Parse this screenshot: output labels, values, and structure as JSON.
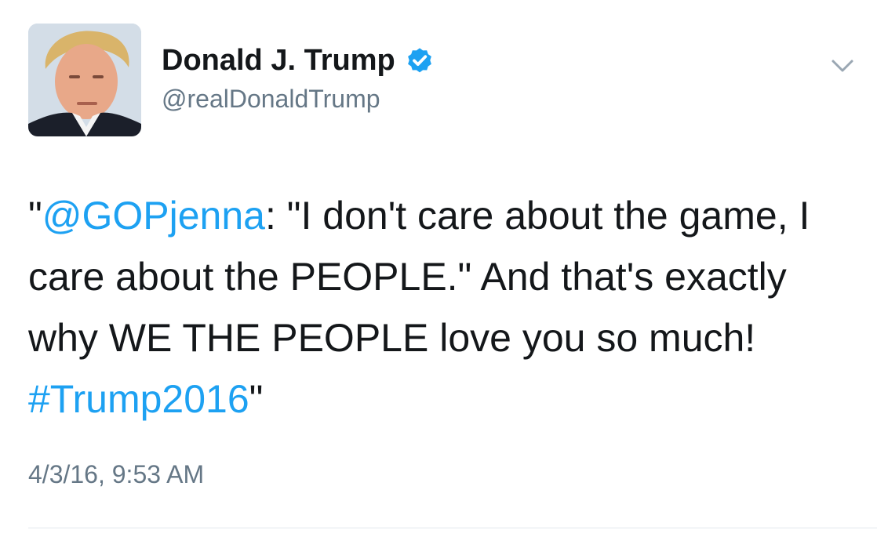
{
  "author": {
    "display_name": "Donald J. Trump",
    "handle": "@realDonaldTrump",
    "verified": true,
    "avatar_icon": "profile-photo"
  },
  "tweet": {
    "quote_open": "\"",
    "mention": "@GOPjenna",
    "text_part1": ": \"I don't care about the game, I care about the PEOPLE.\" And that's exactly why WE THE PEOPLE love you so much! ",
    "hashtag": "#Trump2016",
    "quote_close": "\"",
    "timestamp": "4/3/16, 9:53 AM"
  },
  "menu": {
    "icon": "chevron-down-icon"
  },
  "colors": {
    "link": "#1da1f2",
    "secondary_text": "#657786",
    "primary_text": "#14171a",
    "verified_badge": "#1da1f2",
    "divider": "#e1e8ed"
  }
}
